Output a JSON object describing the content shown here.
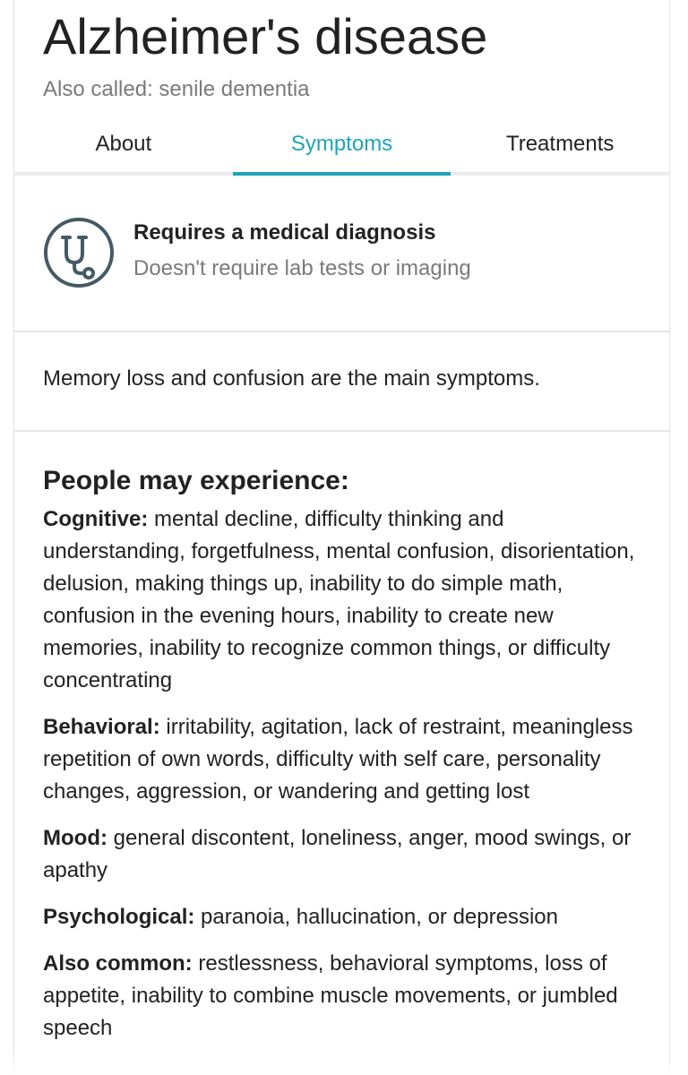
{
  "header": {
    "title": "Alzheimer's disease",
    "subtitle": "Also called: senile dementia"
  },
  "tabs": [
    {
      "label": "About",
      "active": false
    },
    {
      "label": "Symptoms",
      "active": true
    },
    {
      "label": "Treatments",
      "active": false
    }
  ],
  "diagnosis": {
    "icon": "stethoscope-icon",
    "title": "Requires a medical diagnosis",
    "subtitle": "Doesn't require lab tests or imaging"
  },
  "summary": "Memory loss and confusion are the main symptoms.",
  "symptoms": {
    "heading": "People may experience:",
    "items": [
      {
        "label": "Cognitive:",
        "text": " mental decline, difficulty thinking and understanding, forgetfulness, mental confusion, disorientation, delusion, making things up, inability to do simple math, confusion in the evening hours, inability to create new memories, inability to recognize common things, or difficulty concentrating"
      },
      {
        "label": "Behavioral:",
        "text": " irritability, agitation, lack of restraint, meaningless repetition of own words, difficulty with self care, personality changes, aggression, or wandering and getting lost"
      },
      {
        "label": "Mood:",
        "text": " general discontent, loneliness, anger, mood swings, or apathy"
      },
      {
        "label": "Psychological:",
        "text": " paranoia, hallucination, or depression"
      },
      {
        "label": "Also common:",
        "text": " restlessness, behavioral symptoms, loss of appetite, inability to combine muscle movements, or jumbled speech"
      }
    ]
  },
  "colors": {
    "accent": "#1ea5b8",
    "text": "#222222",
    "muted": "#7a7a7a",
    "icon": "#455a64"
  }
}
